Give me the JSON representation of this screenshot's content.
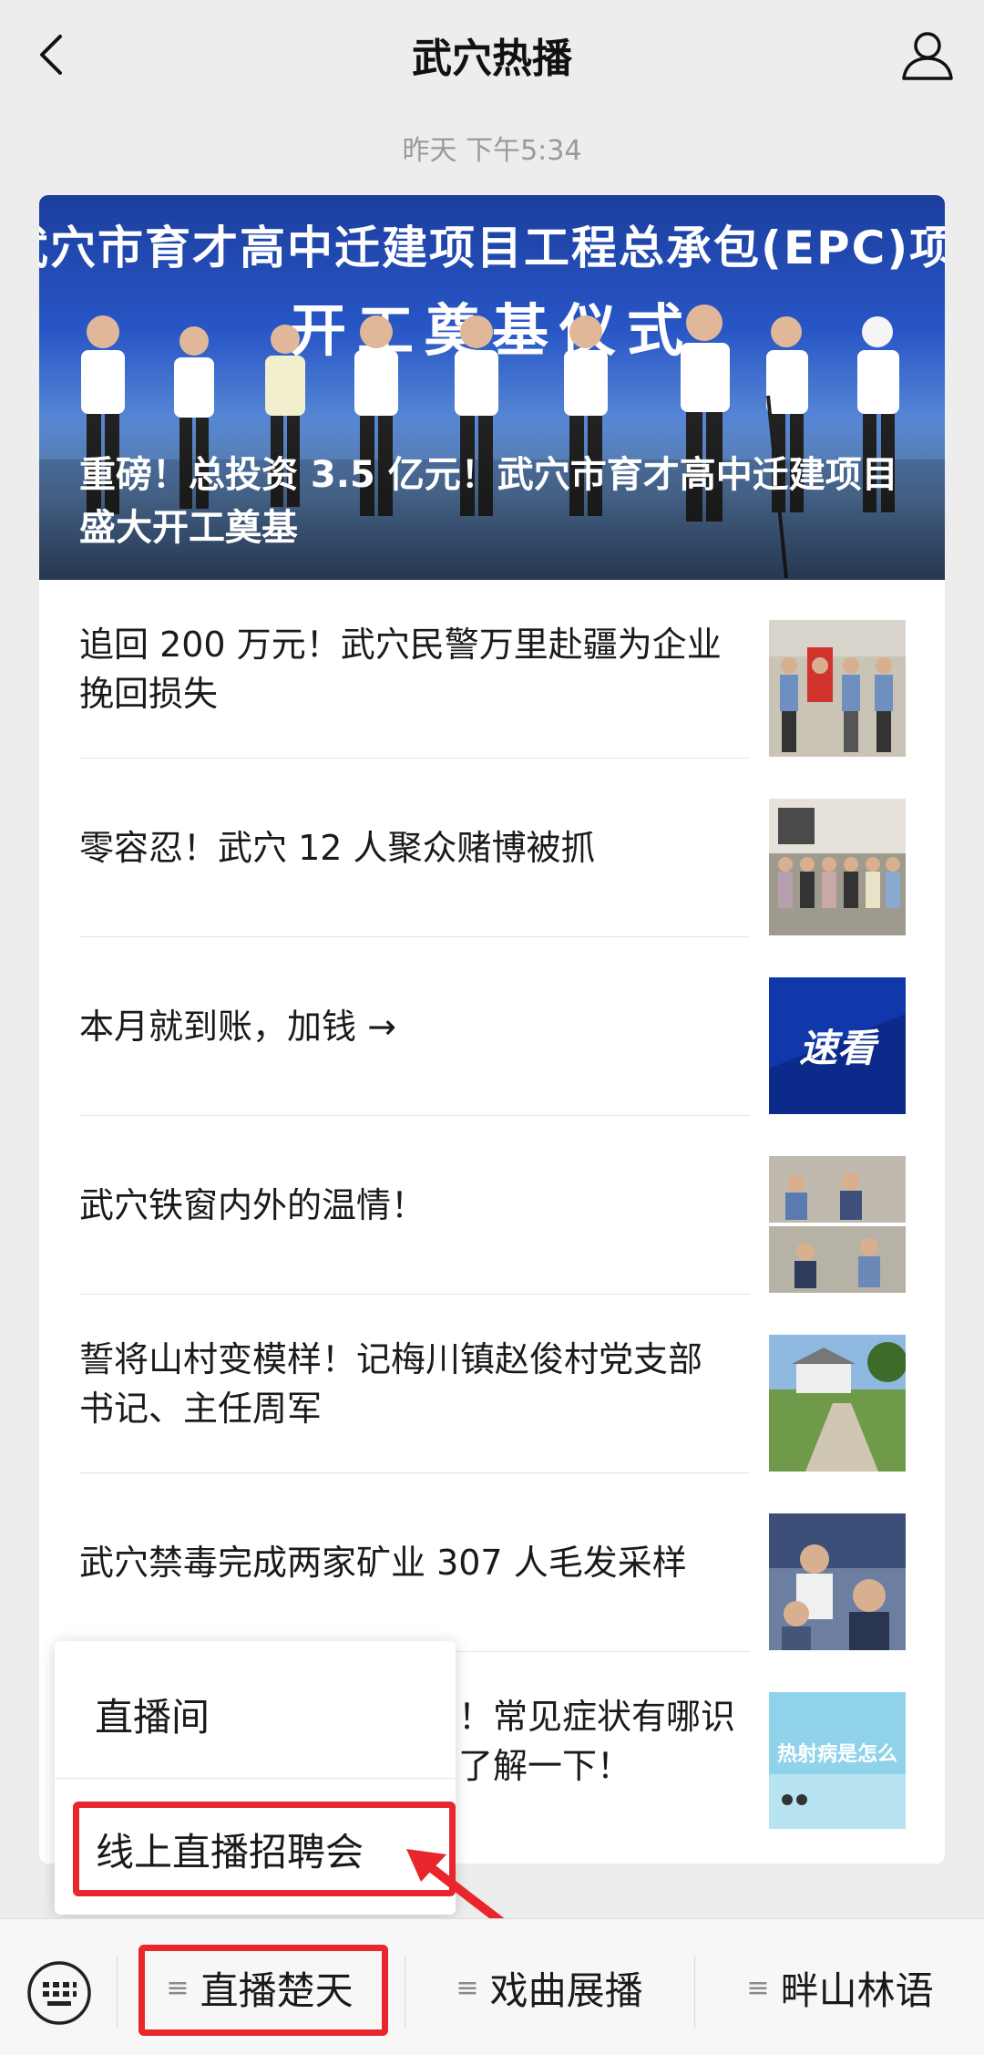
{
  "header": {
    "title": "武穴热播"
  },
  "timestamp": "昨天 下午5:34",
  "hero": {
    "banner_line1": "武穴市育才高中迁建项目工程总承包(EPC)项目",
    "banner_line2": "开工奠基仪式",
    "headline": "重磅！总投资 3.5 亿元！武穴市育才高中迁建项目盛大开工奠基"
  },
  "articles": [
    {
      "title": "追回 200 万元！武穴民警万里赴疆为企业挽回损失",
      "thumb": "police-banner-photo"
    },
    {
      "title": "零容忍！武穴 12 人聚众赌博被抓",
      "thumb": "group-photo"
    },
    {
      "title": "本月就到账，加钱 →",
      "thumb": "速看"
    },
    {
      "title": "武穴铁窗内外的温情！",
      "thumb": "meeting-photos"
    },
    {
      "title": "誓将山村变模样！记梅川镇赵俊村党支部书记、主任周军",
      "thumb": "village-road-photo"
    },
    {
      "title": "武穴禁毒完成两家矿业 307 人毛发采样",
      "thumb": "sampling-photo"
    },
    {
      "title": "！常见症状有哪识了解一下！",
      "thumb": "热射病是怎么"
    }
  ],
  "popup": {
    "option1": "直播间",
    "option2": "线上直播招聘会"
  },
  "bottom_tabs": [
    {
      "label": "直播楚天"
    },
    {
      "label": "戏曲展播"
    },
    {
      "label": "畔山林语"
    }
  ],
  "menu_glyph": "≡",
  "colors": {
    "highlight": "#e8262b",
    "hero_blue": "#2856c6"
  }
}
